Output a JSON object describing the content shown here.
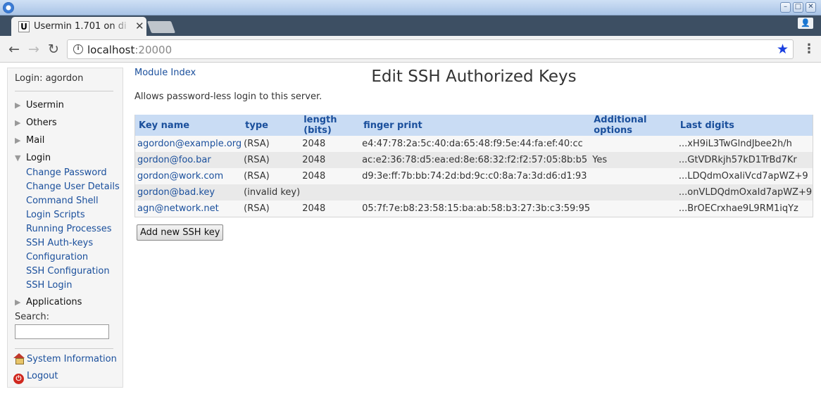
{
  "browser": {
    "tab_title": "Usermin 1.701 on di",
    "tab_favicon_letter": "U",
    "url_host": "localhost",
    "url_port": ":20000"
  },
  "sidebar": {
    "login_text": "Login: agordon",
    "categories": {
      "usermin": "Usermin",
      "others": "Others",
      "mail": "Mail",
      "login": "Login",
      "applications": "Applications"
    },
    "login_items": [
      "Change Password",
      "Change User Details",
      "Command Shell",
      "Login Scripts",
      "Running Processes",
      "SSH Auth-keys",
      "Configuration",
      "SSH Configuration",
      "SSH Login"
    ],
    "search_label": "Search:",
    "search_value": "",
    "system_information": "System Information",
    "logout": "Logout"
  },
  "main": {
    "module_index": "Module Index",
    "title": "Edit SSH Authorized Keys",
    "description": "Allows password-less login to this server.",
    "columns": [
      "Key name",
      "type",
      "length (bits)",
      "finger print",
      "Additional options",
      "Last digits"
    ],
    "rows": [
      {
        "name": "agordon@example.org",
        "type": "(RSA)",
        "length": "2048",
        "fingerprint": "e4:47:78:2a:5c:40:da:65:48:f9:5e:44:fa:ef:40:cc",
        "options": "",
        "last": "...xH9iL3TwGlndJbee2h/h"
      },
      {
        "name": "gordon@foo.bar",
        "type": "(RSA)",
        "length": "2048",
        "fingerprint": "ac:e2:36:78:d5:ea:ed:8e:68:32:f2:f2:57:05:8b:b5",
        "options": "Yes",
        "last": "...GtVDRkjh57kD1TrBd7Kr"
      },
      {
        "name": "gordon@work.com",
        "type": "(RSA)",
        "length": "2048",
        "fingerprint": "d9:3e:ff:7b:bb:74:2d:bd:9c:c0:8a:7a:3d:d6:d1:93",
        "options": "",
        "last": "...LDQdmOxaIiVcd7apWZ+9"
      },
      {
        "name": "gordon@bad.key",
        "type": "(invalid key)",
        "length": "",
        "fingerprint": "",
        "options": "",
        "last": "...onVLDQdmOxaId7apWZ+9"
      },
      {
        "name": "agn@network.net",
        "type": "(RSA)",
        "length": "2048",
        "fingerprint": "05:7f:7e:b8:23:58:15:ba:ab:58:b3:27:3b:c3:59:95",
        "options": "",
        "last": "...BrOECrxhae9L9RM1iqYz"
      }
    ],
    "add_button": "Add new SSH key"
  }
}
